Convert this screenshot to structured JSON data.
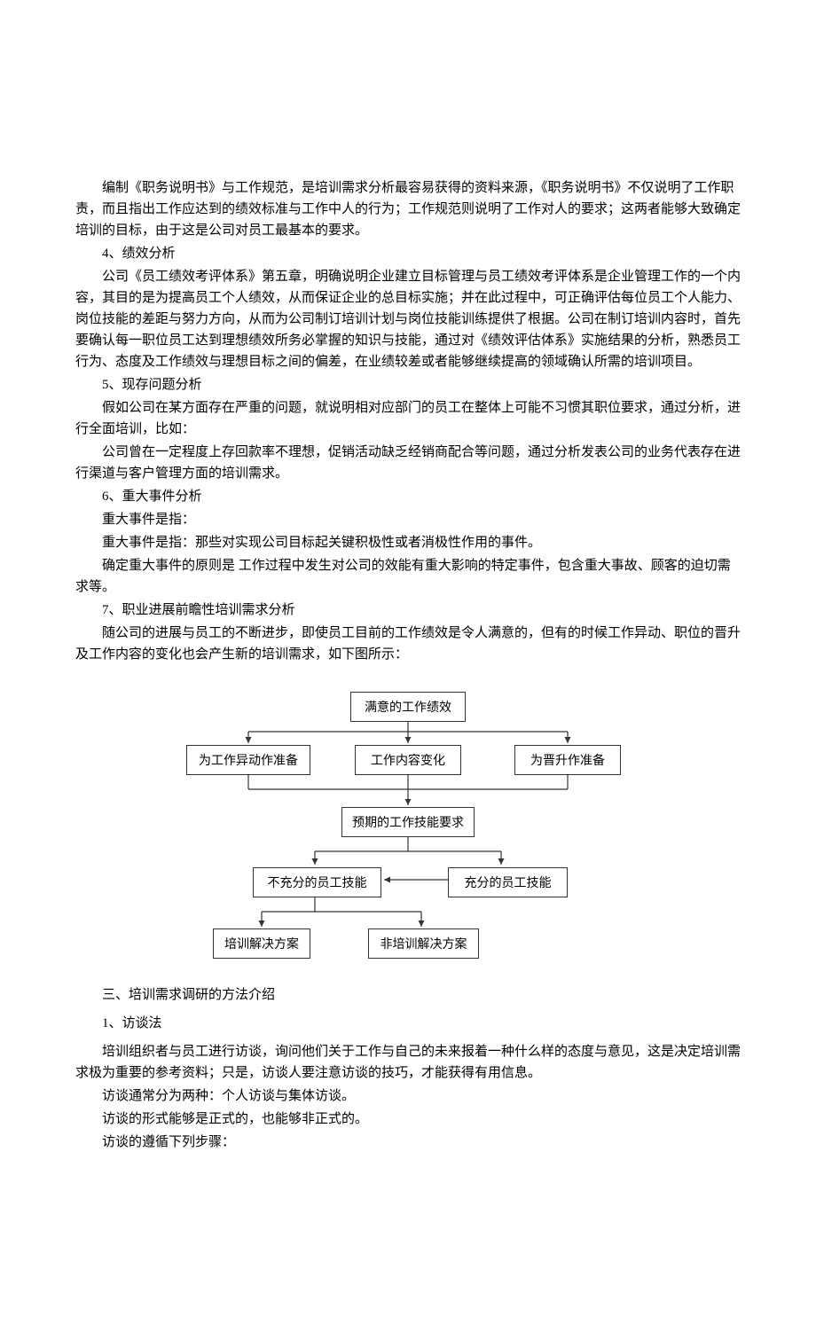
{
  "p1": "编制《职务说明书》与工作规范，是培训需求分析最容易获得的资料来源，《职务说明书》不仅说明了工作职责，而且指出工作应达到的绩效标准与工作中人的行为；工作规范则说明了工作对人的要求；这两者能够大致确定培训的目标，由于这是公司对员工最基本的要求。",
  "h4": "4、绩效分析",
  "p4": "公司《员工绩效考评体系》第五章，明确说明企业建立目标管理与员工绩效考评体系是企业管理工作的一个内容，其目的是为提高员工个人绩效，从而保证企业的总目标实施；并在此过程中，可正确评估每位员工个人能力、岗位技能的差距与努力方向，从而为公司制订培训计划与岗位技能训练提供了根据。公司在制订培训内容时，首先要确认每一职位员工达到理想绩效所务必掌握的知识与技能，通过对《绩效评估体系》实施结果的分析，熟悉员工行为、态度及工作绩效与理想目标之间的偏差，在业绩较差或者能够继续提高的领域确认所需的培训项目。",
  "h5": "5、现存问题分析",
  "p5a": "假如公司在某方面存在严重的问题，就说明相对应部门的员工在整体上可能不习惯其职位要求，通过分析，进行全面培训，比如：",
  "p5b": "公司曾在一定程度上存回款率不理想，促销活动缺乏经销商配合等问题，通过分析发表公司的业务代表存在进行渠道与客户管理方面的培训需求。",
  "h6": "6、重大事件分析",
  "p6a": "重大事件是指：",
  "p6b": "重大事件是指：那些对实现公司目标起关键积极性或者消极性作用的事件。",
  "p6c": "确定重大事件的原则是  工作过程中发生对公司的效能有重大影响的特定事件，包含重大事故、顾客的迫切需求等。",
  "h7": "7、职业进展前瞻性培训需求分析",
  "p7": "随公司的进展与员工的不断进步，即使员工目前的工作绩效是令人满意的，但有的时候工作异动、职位的晋升及工作内容的变化也会产生新的培训需求，如下图所示：",
  "diagram": {
    "b1": "满意的工作绩效",
    "b2a": "为工作异动作准备",
    "b2b": "工作内容变化",
    "b2c": "为晋升作准备",
    "b3": "预期的工作技能要求",
    "b4a": "不充分的员工技能",
    "b4b": "充分的员工技能",
    "b5a": "培训解决方案",
    "b5b": "非培训解决方案"
  },
  "s3": "三、培训需求调研的方法介绍",
  "m1": "1、访谈法",
  "m1p1": "培训组织者与员工进行访谈，询问他们关于工作与自己的未来报着一种什么样的态度与意见，这是决定培训需求极为重要的参考资料；只是，访谈人要注意访谈的技巧，才能获得有用信息。",
  "m1p2": "访谈通常分为两种：个人访谈与集体访谈。",
  "m1p3": "访谈的形式能够是正式的，也能够非正式的。",
  "m1p4": "访谈的遵循下列步骤："
}
